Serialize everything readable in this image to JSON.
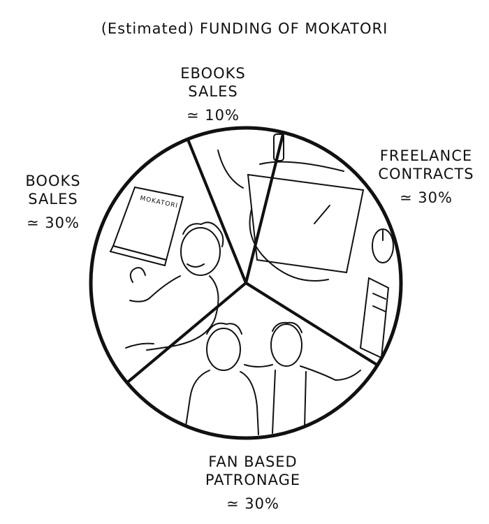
{
  "chart_data": {
    "type": "pie",
    "title": "(Estimated) FUNDING OF MOKATORI",
    "categories": [
      "EBOOKS SALES",
      "FREELANCE CONTRACTS",
      "FAN BASED PATRONAGE",
      "BOOKS SALES"
    ],
    "values": [
      10,
      30,
      30,
      30
    ],
    "value_labels": [
      "≃ 10%",
      "≃ 30%",
      "≃ 30%",
      "≃ 30%"
    ],
    "label_lines": [
      [
        "EBOOKS",
        "SALES"
      ],
      [
        "FREELANCE",
        "CONTRACTS"
      ],
      [
        "FAN BASED",
        "PATRONAGE"
      ],
      [
        "BOOKS",
        "SALES"
      ]
    ],
    "book_cover_text": "MOKATORI",
    "legend": "none",
    "colors": {
      "stroke": "#111111",
      "fill": "#ffffff"
    }
  }
}
